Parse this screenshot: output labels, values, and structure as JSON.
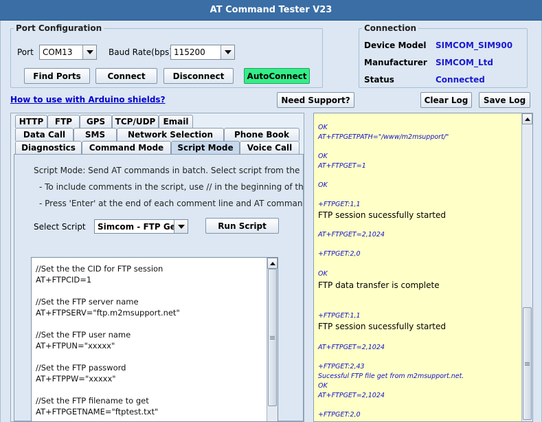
{
  "window": {
    "title": "AT Command Tester V23"
  },
  "port_config": {
    "legend": "Port Configuration",
    "port_label": "Port",
    "port_value": "COM13",
    "baud_label": "Baud Rate(bps)",
    "baud_value": "115200",
    "buttons": {
      "find_ports": "Find Ports",
      "connect": "Connect",
      "disconnect": "Disconnect",
      "autoconnect": "AutoConnect"
    }
  },
  "connection": {
    "legend": "Connection",
    "device_model_label": "Device Model",
    "device_model_value": "SIMCOM_SIM900",
    "manufacturer_label": "Manufacturer",
    "manufacturer_value": "SIMCOM_Ltd",
    "status_label": "Status",
    "status_value": "Connected"
  },
  "toolbar": {
    "arduino_link": "How to use with Arduino shields?",
    "need_support": "Need Support?",
    "clear_log": "Clear Log",
    "save_log": "Save Log"
  },
  "tabs": {
    "row1": [
      "HTTP",
      "FTP",
      "GPS",
      "TCP/UDP",
      "Email"
    ],
    "row2": [
      "Data Call",
      "SMS",
      "Network Selection",
      "Phone Book"
    ],
    "row3": [
      "Diagnostics",
      "Command Mode",
      "Script Mode",
      "Voice Call"
    ],
    "selected": "Script Mode"
  },
  "script_mode": {
    "desc1": "Script Mode: Send AT commands in batch. Select script from the drop",
    "desc2": "- To include comments in the script, use // in the beginning of the line",
    "desc3": "- Press 'Enter' at the end of each comment line and AT command line",
    "select_label": "Select Script",
    "select_value": "Simcom - FTP Get",
    "run_button": "Run Script",
    "script_lines": [
      "//Set the the CID for FTP session",
      "AT+FTPCID=1",
      "",
      "//Set the FTP server name",
      "AT+FTPSERV=\"ftp.m2msupport.net\"",
      "",
      "//Set the FTP user name",
      "AT+FTPUN=\"xxxxx\"",
      "",
      "//Set the FTP password",
      "AT+FTPPW=\"xxxxx\"",
      "",
      "//Set the FTP filename to get",
      "AT+FTPGETNAME=\"ftptest.txt\""
    ]
  },
  "log": [
    {
      "kind": "cmd",
      "text": "OK"
    },
    {
      "kind": "cmd",
      "text": "AT+FTPGETPATH=\"/www/m2msupport/\""
    },
    {
      "kind": "cmd",
      "text": "OK"
    },
    {
      "kind": "cmd",
      "text": "AT+FTPGET=1"
    },
    {
      "kind": "cmd",
      "text": "OK"
    },
    {
      "kind": "cmd",
      "text": "+FTPGET:1,1"
    },
    {
      "kind": "msg",
      "text": "FTP session sucessfully started"
    },
    {
      "kind": "cmd",
      "text": "AT+FTPGET=2,1024"
    },
    {
      "kind": "cmd",
      "text": "+FTPGET:2,0"
    },
    {
      "kind": "cmd",
      "text": "OK"
    },
    {
      "kind": "msg",
      "text": "FTP data transfer is complete"
    },
    {
      "kind": "cmd",
      "text": "+FTPGET:1,1"
    },
    {
      "kind": "msg",
      "text": "FTP session sucessfully started"
    },
    {
      "kind": "cmd",
      "text": "AT+FTPGET=2,1024"
    },
    {
      "kind": "cmd",
      "text": "+FTPGET:2,43"
    },
    {
      "kind": "cmd",
      "text": "Sucessful FTP file get from m2msupport.net."
    },
    {
      "kind": "cmd",
      "text": "OK"
    },
    {
      "kind": "cmd",
      "text": "AT+FTPGET=2,1024"
    },
    {
      "kind": "cmd",
      "text": "+FTPGET:2,0"
    }
  ],
  "colors": {
    "autoconnect": "#33ee88",
    "log_background": "#ffffc8",
    "titlebar": "#3a6ea5",
    "value_text": "#1a1ad0"
  }
}
